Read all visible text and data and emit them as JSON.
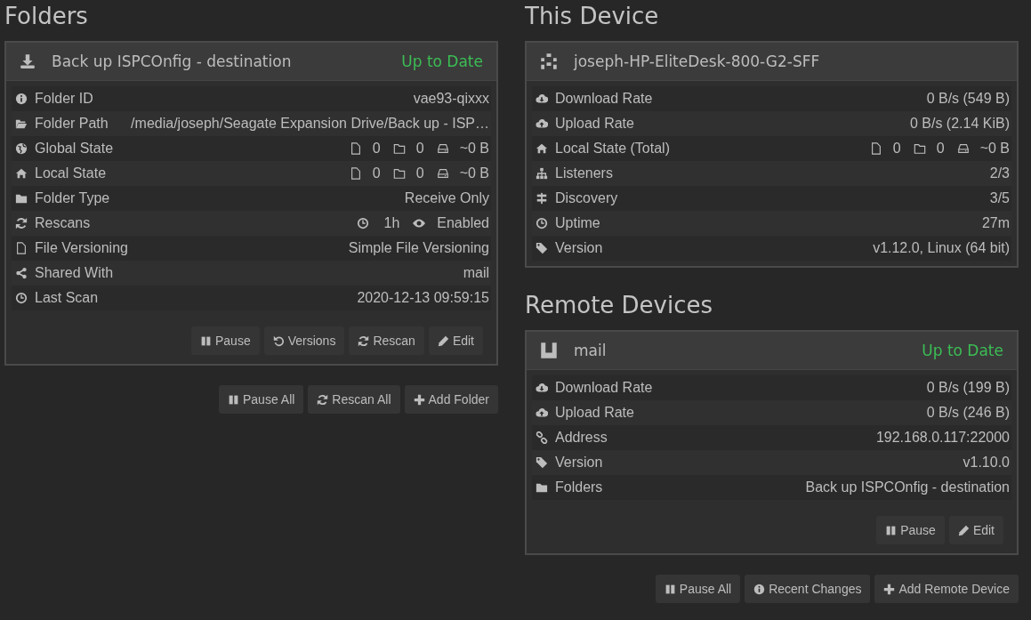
{
  "folders_section": {
    "title": "Folders",
    "folders": [
      {
        "name": "Back up ISPCOnfig - destination",
        "status": "Up to Date",
        "rows": [
          {
            "kind": "text",
            "label": "Folder ID",
            "value": "vae93-qixxx"
          },
          {
            "kind": "text",
            "label": "Folder Path",
            "value": "/media/joseph/Seagate Expansion Drive/Back up - ISP…"
          },
          {
            "kind": "counts",
            "label": "Global State",
            "files": "0",
            "folders": "0",
            "size": "~0 B"
          },
          {
            "kind": "counts",
            "label": "Local State",
            "files": "0",
            "folders": "0",
            "size": "~0 B"
          },
          {
            "kind": "text",
            "label": "Folder Type",
            "value": "Receive Only"
          },
          {
            "kind": "rescan",
            "label": "Rescans",
            "interval": "1h",
            "watcher": "Enabled"
          },
          {
            "kind": "text",
            "label": "File Versioning",
            "value": "Simple File Versioning"
          },
          {
            "kind": "text",
            "label": "Shared With",
            "value": "mail"
          },
          {
            "kind": "text",
            "label": "Last Scan",
            "value": "2020-12-13 09:59:15"
          }
        ],
        "buttons": [
          "Pause",
          "Versions",
          "Rescan",
          "Edit"
        ]
      }
    ],
    "buttons": [
      "Pause All",
      "Rescan All",
      "Add Folder"
    ]
  },
  "this_device": {
    "title": "This Device",
    "name": "joseph-HP-EliteDesk-800-G2-SFF",
    "rows": [
      {
        "kind": "text",
        "label": "Download Rate",
        "value": "0 B/s (549 B)"
      },
      {
        "kind": "text",
        "label": "Upload Rate",
        "value": "0 B/s (2.14 KiB)"
      },
      {
        "kind": "counts",
        "label": "Local State (Total)",
        "files": "0",
        "folders": "0",
        "size": "~0 B"
      },
      {
        "kind": "text",
        "label": "Listeners",
        "value": "2/3"
      },
      {
        "kind": "text",
        "label": "Discovery",
        "value": "3/5"
      },
      {
        "kind": "text",
        "label": "Uptime",
        "value": "27m"
      },
      {
        "kind": "text",
        "label": "Version",
        "value": "v1.12.0, Linux (64 bit)"
      }
    ]
  },
  "remote_devices": {
    "title": "Remote Devices",
    "devices": [
      {
        "name": "mail",
        "status": "Up to Date",
        "rows": [
          {
            "kind": "text",
            "label": "Download Rate",
            "value": "0 B/s (199 B)"
          },
          {
            "kind": "text",
            "label": "Upload Rate",
            "value": "0 B/s (246 B)"
          },
          {
            "kind": "text",
            "label": "Address",
            "value": "192.168.0.117:22000"
          },
          {
            "kind": "text",
            "label": "Version",
            "value": "v1.10.0"
          },
          {
            "kind": "text",
            "label": "Folders",
            "value": "Back up ISPCOnfig - destination"
          }
        ],
        "buttons": [
          "Pause",
          "Edit"
        ]
      }
    ],
    "buttons": [
      "Pause All",
      "Recent Changes",
      "Add Remote Device"
    ]
  }
}
